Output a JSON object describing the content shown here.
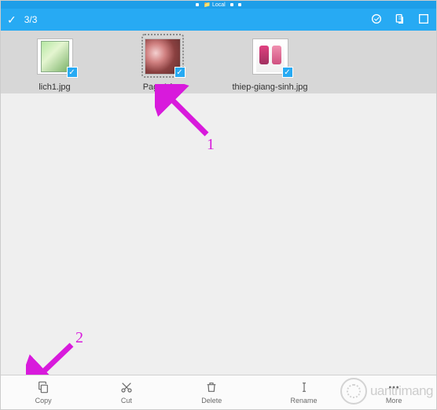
{
  "status_bar": {
    "location": "Local"
  },
  "header": {
    "selection_count": "3/3"
  },
  "files": [
    {
      "name": "lich1.jpg",
      "selected": true
    },
    {
      "name": "Page1.jpg",
      "selected": true
    },
    {
      "name": "thiep-giang-sinh.jpg",
      "selected": true
    }
  ],
  "bottom_actions": {
    "copy": "Copy",
    "cut": "Cut",
    "delete": "Delete",
    "rename": "Rename",
    "more": "More"
  },
  "annotations": {
    "label1": "1",
    "label2": "2"
  },
  "watermark": "uantrimang"
}
